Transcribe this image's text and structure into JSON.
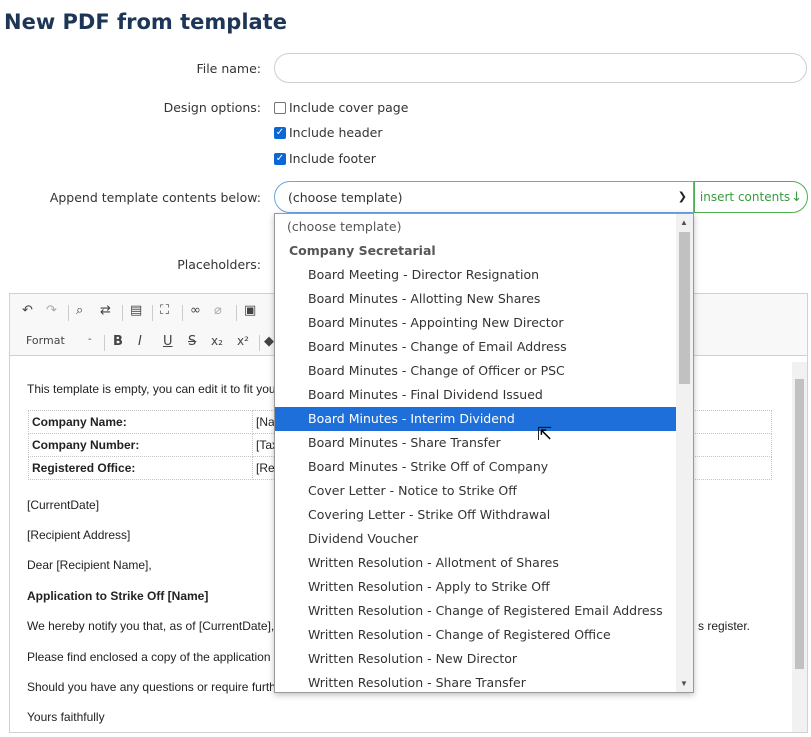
{
  "page": {
    "title": "New PDF from template"
  },
  "form": {
    "file_name_label": "File name:",
    "file_name_value": "",
    "design_options_label": "Design options:",
    "options": [
      {
        "label": "Include cover page",
        "checked": false
      },
      {
        "label": "Include header",
        "checked": true
      },
      {
        "label": "Include footer",
        "checked": true
      }
    ],
    "append_label": "Append template contents below:",
    "select_value": "(choose template)",
    "insert_label": "insert contents",
    "placeholders_label": "Placeholders:"
  },
  "dropdown": {
    "placeholder": "(choose template)",
    "group": "Company Secretarial",
    "selected_index": 6,
    "items": [
      "Board Meeting - Director Resignation",
      "Board Minutes - Allotting New Shares",
      "Board Minutes - Appointing New Director",
      "Board Minutes - Change of Email Address",
      "Board Minutes - Change of Officer or PSC",
      "Board Minutes - Final Dividend Issued",
      "Board Minutes - Interim Dividend",
      "Board Minutes - Share Transfer",
      "Board Minutes - Strike Off of Company",
      "Cover Letter - Notice to Strike Off",
      "Covering Letter - Strike Off Withdrawal",
      "Dividend Voucher",
      "Written Resolution - Allotment of Shares",
      "Written Resolution - Apply to Strike Off",
      "Written Resolution - Change of Registered Email Address",
      "Written Resolution - Change of Registered Office",
      "Written Resolution - New Director",
      "Written Resolution - Share Transfer"
    ]
  },
  "editor": {
    "toolbar": {
      "format_label": "Format",
      "bold": "B",
      "italic": "I",
      "underline": "U",
      "strike": "S",
      "subscript": "x₂",
      "superscript": "x²"
    },
    "intro": "This template is empty, you can edit it to fit your",
    "table": [
      {
        "key": "Company Name:",
        "value": "[Nar"
      },
      {
        "key": "Company Number:",
        "value": "[Tax"
      },
      {
        "key": "Registered Office:",
        "value": "[Reg"
      }
    ],
    "current_date": "[CurrentDate]",
    "recipient_address": "[Recipient Address]",
    "salutation": "Dear [Recipient Name],",
    "heading": "Application to Strike Off [Name]",
    "para1": "We hereby notify you that, as of [CurrentDate], t",
    "para1_tail": "s register.",
    "para2": "Please find enclosed a copy of the application fo",
    "para3": "Should you have any questions or require furthe",
    "closing": "Yours faithfully"
  }
}
